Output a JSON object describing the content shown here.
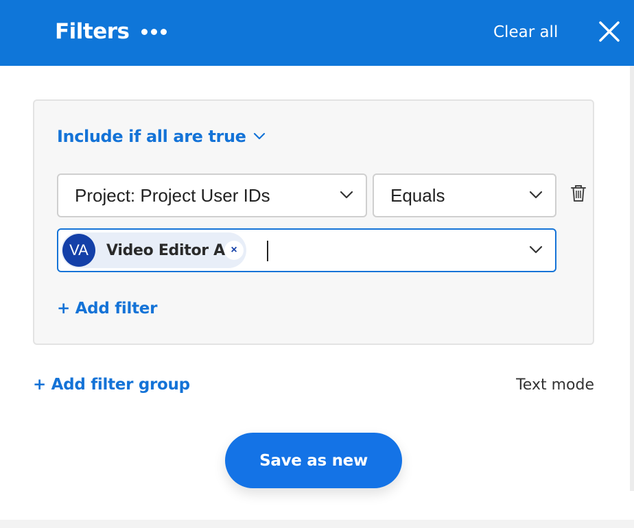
{
  "header": {
    "title": "Filters",
    "more_icon": "more-dots-icon",
    "clear_label": "Clear all",
    "close_icon": "close-icon",
    "bg_color": "#0f76d9"
  },
  "group": {
    "condition_label": "Include if all are true",
    "filter": {
      "field_value": "Project: Project User IDs",
      "operator_value": "Equals",
      "delete_icon": "trash-icon",
      "values": [
        {
          "initials": "VA",
          "label": "Video Editor A"
        }
      ]
    },
    "add_filter_label": "+ Add filter"
  },
  "add_group_label": "+ Add filter group",
  "text_mode_label": "Text mode",
  "save_label": "Save as new",
  "accent_color": "#1473d7"
}
